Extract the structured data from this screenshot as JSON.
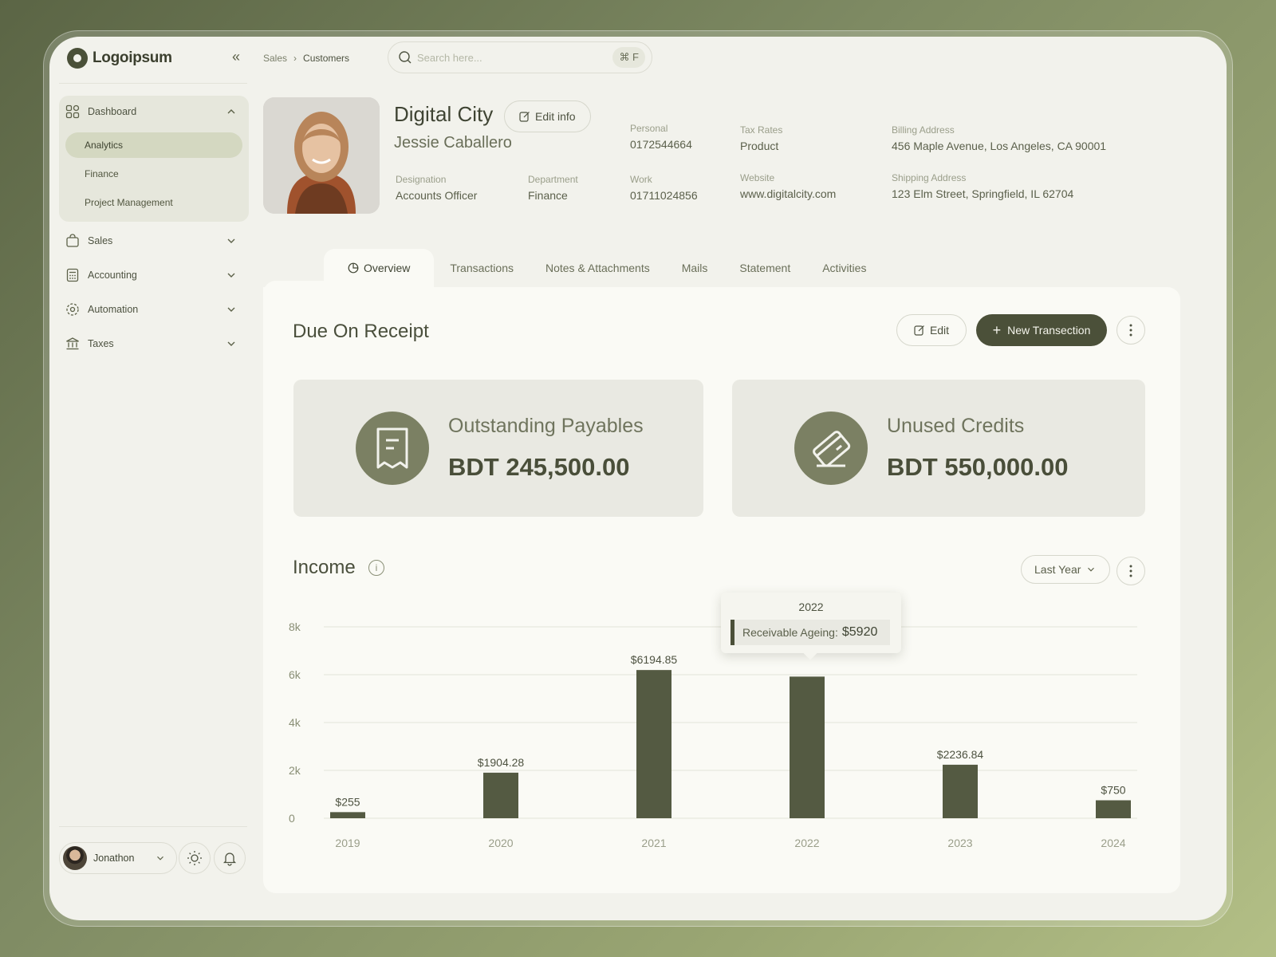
{
  "app": {
    "logo": "Logoipsum"
  },
  "sidebar": {
    "dashboard": {
      "label": "Dashboard",
      "items": [
        {
          "label": "Analytics",
          "active": true
        },
        {
          "label": "Finance"
        },
        {
          "label": "Project Management"
        }
      ]
    },
    "items": [
      {
        "label": "Sales",
        "icon": "shopping-bag-icon"
      },
      {
        "label": "Accounting",
        "icon": "calculator-icon"
      },
      {
        "label": "Automation",
        "icon": "automation-icon"
      },
      {
        "label": "Taxes",
        "icon": "bank-icon"
      }
    ],
    "user": {
      "name": "Jonathon"
    }
  },
  "topbar": {
    "breadcrumb": [
      "Sales",
      "Customers"
    ],
    "search": {
      "placeholder": "Search here...",
      "shortcut": "⌘ F"
    }
  },
  "profile": {
    "company": "Digital City",
    "name": "Jessie Caballero",
    "edit_label": "Edit info",
    "fields": {
      "designation": {
        "label": "Designation",
        "value": "Accounts Officer"
      },
      "department": {
        "label": "Department",
        "value": "Finance"
      },
      "personal": {
        "label": "Personal",
        "value": "0172544664"
      },
      "work": {
        "label": "Work",
        "value": "01711024856"
      },
      "tax_rates": {
        "label": "Tax Rates",
        "value": "Product"
      },
      "website": {
        "label": "Website",
        "value": "www.digitalcity.com"
      },
      "billing": {
        "label": "Billing Address",
        "value": "456 Maple Avenue, Los Angeles, CA 90001"
      },
      "shipping": {
        "label": "Shipping Address",
        "value": "123 Elm Street, Springfield, IL 62704"
      }
    }
  },
  "tabs": [
    "Overview",
    "Transactions",
    "Notes & Attachments",
    "Mails",
    "Statement",
    "Activities"
  ],
  "due": {
    "title": "Due On Receipt",
    "edit_label": "Edit",
    "new_label": "New Transection",
    "cards": [
      {
        "label": "Outstanding Payables",
        "value": "BDT 245,500.00",
        "icon": "receipt-icon"
      },
      {
        "label": "Unused Credits",
        "value": "BDT 550,000.00",
        "icon": "credit-card-icon"
      }
    ]
  },
  "income": {
    "title": "Income",
    "period": "Last Year",
    "tooltip": {
      "year": "2022",
      "label": "Receivable Ageing:",
      "value": "$5920"
    }
  },
  "chart_data": {
    "type": "bar",
    "categories": [
      "2019",
      "2020",
      "2021",
      "2022",
      "2023",
      "2024"
    ],
    "values": [
      255,
      1904.28,
      6194.85,
      5920,
      2236.84,
      750
    ],
    "data_labels": [
      "$255",
      "$1904.28",
      "$6194.85",
      "",
      "$2236.84",
      "$750"
    ],
    "yticks": [
      "0",
      "2k",
      "4k",
      "6k",
      "8k"
    ],
    "ylim": [
      0,
      8000
    ],
    "grid": true,
    "bar_color": "#545a42"
  }
}
